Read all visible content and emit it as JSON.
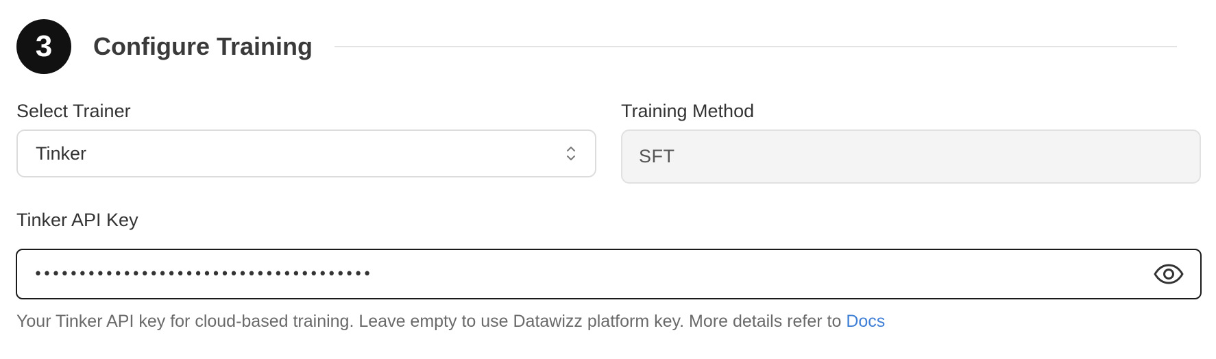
{
  "section": {
    "step_number": "3",
    "title": "Configure Training"
  },
  "trainer": {
    "label": "Select Trainer",
    "selected": "Tinker"
  },
  "method": {
    "label": "Training Method",
    "value": "SFT"
  },
  "api_key": {
    "label": "Tinker API Key",
    "masked_value": "••••••••••••••••••••••••••••••••••••••",
    "help_text": "Your Tinker API key for cloud-based training. Leave empty to use Datawizz platform key. More details refer to",
    "help_link_label": "Docs"
  },
  "colors": {
    "accent_link": "#3f7fd6",
    "badge_bg": "#111111",
    "focused_border": "#1a1a1a"
  },
  "icons": {
    "select_arrows": "chevron-up-down-icon",
    "visibility_toggle": "eye-icon"
  }
}
